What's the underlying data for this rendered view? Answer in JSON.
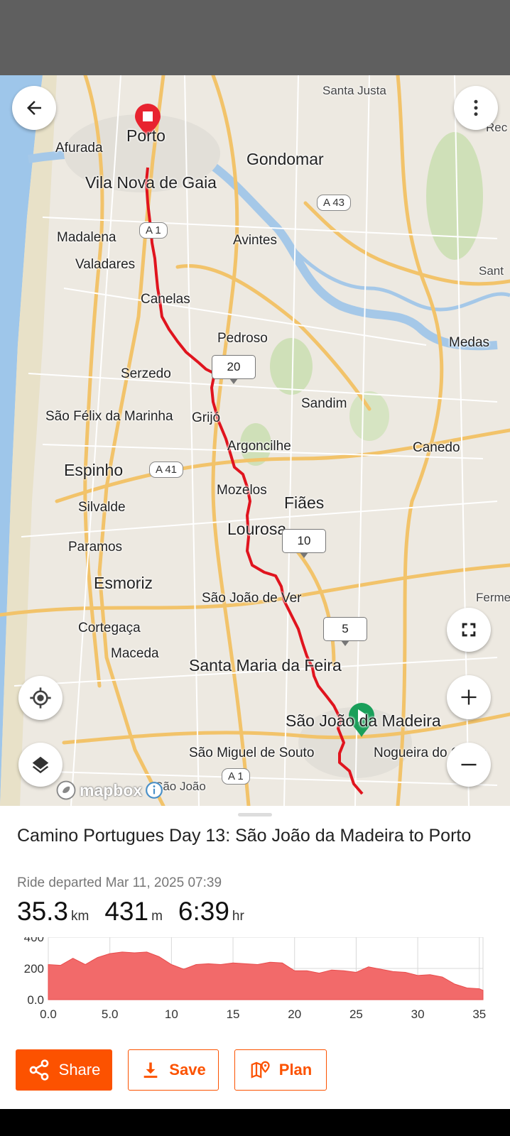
{
  "map": {
    "labels": [
      {
        "text": "Santa Justa"
      },
      {
        "text": "Porto"
      },
      {
        "text": "Afurada"
      },
      {
        "text": "Gondomar"
      },
      {
        "text": "Vila Nova de Gaia"
      },
      {
        "text": "Madalena"
      },
      {
        "text": "Avintes"
      },
      {
        "text": "Valadares"
      },
      {
        "text": "Canelas"
      },
      {
        "text": "Pedroso"
      },
      {
        "text": "Serzedo"
      },
      {
        "text": "Sandim"
      },
      {
        "text": "São Félix da Marinha"
      },
      {
        "text": "Grijó"
      },
      {
        "text": "Argoncilhe"
      },
      {
        "text": "Canedo"
      },
      {
        "text": "Espinho"
      },
      {
        "text": "Mozelos"
      },
      {
        "text": "Fiães"
      },
      {
        "text": "Silvalde"
      },
      {
        "text": "Lourosa"
      },
      {
        "text": "Paramos"
      },
      {
        "text": "Esmoriz"
      },
      {
        "text": "São João de Ver"
      },
      {
        "text": "Cortegaça"
      },
      {
        "text": "Maceda"
      },
      {
        "text": "Santa Maria da Feira"
      },
      {
        "text": "São João da Madeira"
      },
      {
        "text": "São Miguel de Souto"
      },
      {
        "text": "Nogueira do Cravo"
      },
      {
        "text": "Medas"
      },
      {
        "text": "São João"
      },
      {
        "text": "Rec"
      },
      {
        "text": "Sant"
      },
      {
        "text": "Ferme"
      }
    ],
    "road_shields": [
      "A 43",
      "A 1",
      "A 41",
      "A 1"
    ],
    "km_markers": [
      "20",
      "10",
      "5"
    ],
    "attribution": "mapbox",
    "route_color": "#e0141e",
    "start_color": "#1a9f5a",
    "end_color": "#e8232f"
  },
  "activity": {
    "title": "Camino Portugues Day 13: São João da Madeira to Porto",
    "departed": "Ride departed Mar 11, 2025 07:39",
    "distance": "35.3",
    "distance_unit": "km",
    "elevation": "431",
    "elevation_unit": "m",
    "time": "6:39",
    "time_unit": "hr"
  },
  "chart_data": {
    "type": "area",
    "x_ticks": [
      "0.0",
      "5.0",
      "10",
      "15",
      "20",
      "25",
      "30",
      "35"
    ],
    "y_ticks": [
      "0.0",
      "200",
      "400"
    ],
    "xlim": [
      0,
      35.3
    ],
    "ylim": [
      0,
      400
    ],
    "color": "#f26a6a",
    "x": [
      0,
      1,
      2,
      3,
      4,
      5,
      6,
      7,
      8,
      9,
      10,
      11,
      12,
      13,
      14,
      15,
      16,
      17,
      18,
      19,
      20,
      21,
      22,
      23,
      24,
      25,
      26,
      27,
      28,
      29,
      30,
      31,
      32,
      33,
      34,
      35,
      35.3
    ],
    "y": [
      225,
      220,
      265,
      225,
      270,
      295,
      305,
      300,
      305,
      275,
      225,
      195,
      225,
      230,
      225,
      235,
      230,
      225,
      240,
      235,
      185,
      185,
      170,
      190,
      185,
      175,
      210,
      195,
      180,
      175,
      155,
      160,
      145,
      100,
      75,
      70,
      60
    ]
  },
  "buttons": {
    "share": "Share",
    "save": "Save",
    "plan": "Plan"
  },
  "icons": [
    "back-arrow-icon",
    "more-vert-icon",
    "fullscreen-icon",
    "zoom-in-icon",
    "zoom-out-icon",
    "my-location-icon",
    "layers-icon",
    "share-icon",
    "download-icon",
    "map-pin-icon",
    "info-icon"
  ]
}
